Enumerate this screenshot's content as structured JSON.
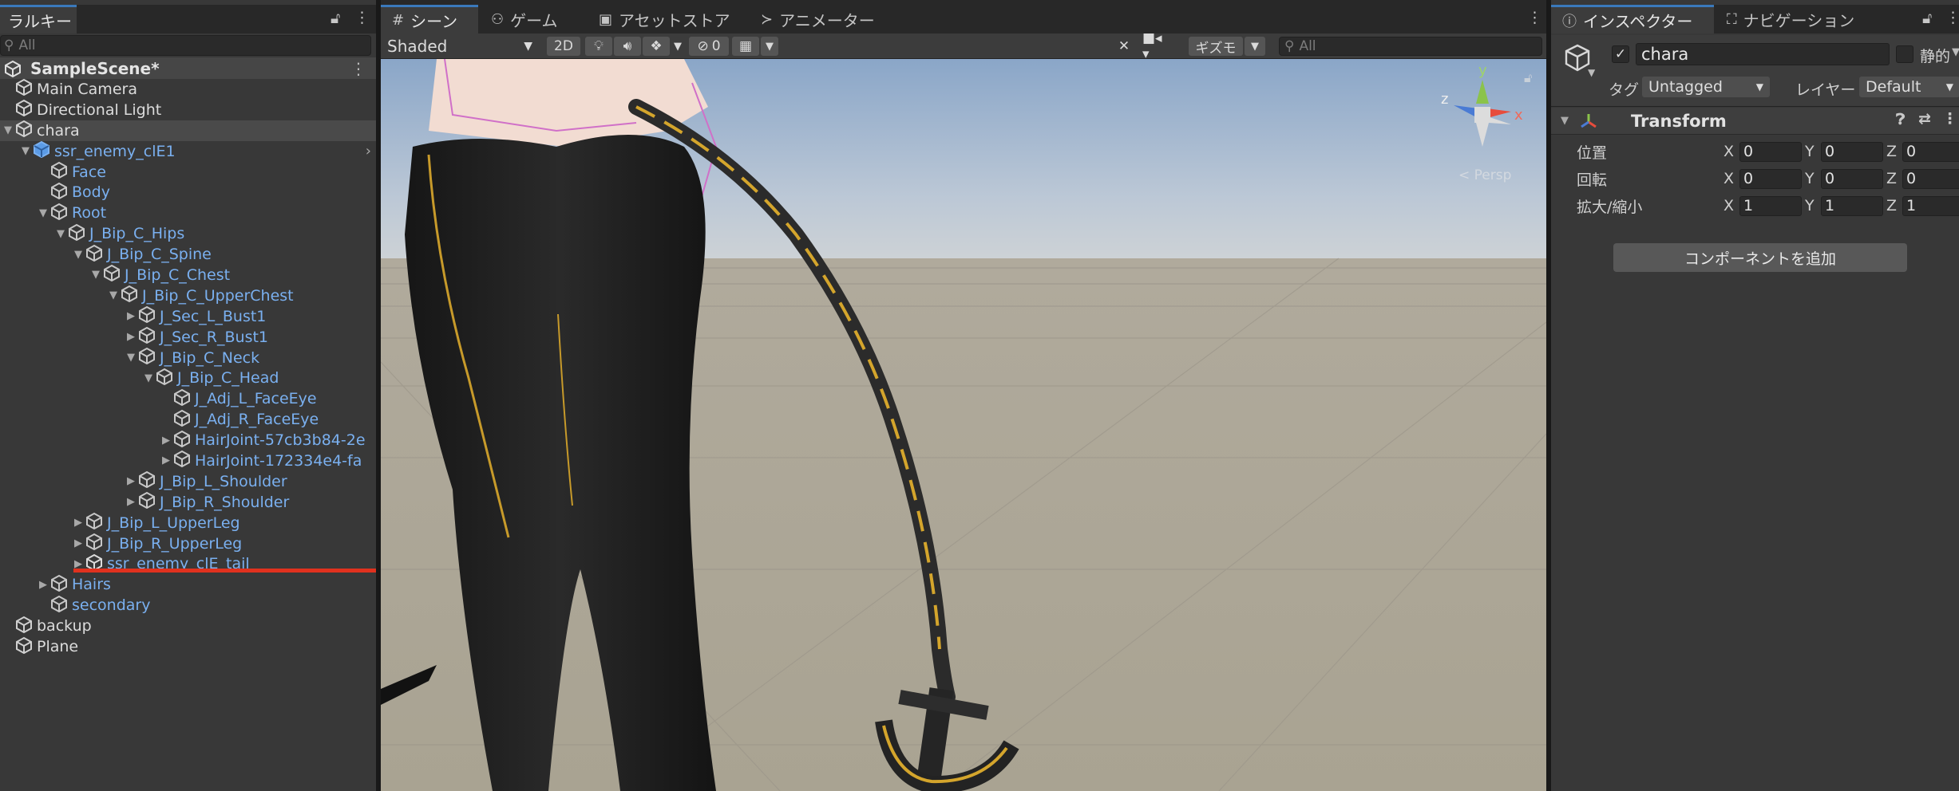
{
  "hierarchy": {
    "tab_label": "ラルキー",
    "search_placeholder": "All",
    "scene_name": "SampleScene*",
    "rows": [
      {
        "label": "Main Camera",
        "depth": 0,
        "arrow": "",
        "color": "white",
        "icon": "cube"
      },
      {
        "label": "Directional Light",
        "depth": 0,
        "arrow": "",
        "color": "white",
        "icon": "cube"
      },
      {
        "label": "chara",
        "depth": 0,
        "arrow": "▼",
        "color": "white",
        "icon": "cube",
        "selected": true
      },
      {
        "label": "ssr_enemy_clE1",
        "depth": 1,
        "arrow": "▼",
        "color": "blue",
        "icon": "prefab",
        "chevron": true
      },
      {
        "label": "Face",
        "depth": 2,
        "arrow": "",
        "color": "blue",
        "icon": "cube"
      },
      {
        "label": "Body",
        "depth": 2,
        "arrow": "",
        "color": "blue",
        "icon": "cube"
      },
      {
        "label": "Root",
        "depth": 2,
        "arrow": "▼",
        "color": "blue",
        "icon": "cube"
      },
      {
        "label": "J_Bip_C_Hips",
        "depth": 3,
        "arrow": "▼",
        "color": "blue",
        "icon": "cube"
      },
      {
        "label": "J_Bip_C_Spine",
        "depth": 4,
        "arrow": "▼",
        "color": "blue",
        "icon": "cube"
      },
      {
        "label": "J_Bip_C_Chest",
        "depth": 5,
        "arrow": "▼",
        "color": "blue",
        "icon": "cube"
      },
      {
        "label": "J_Bip_C_UpperChest",
        "depth": 6,
        "arrow": "▼",
        "color": "blue",
        "icon": "cube"
      },
      {
        "label": "J_Sec_L_Bust1",
        "depth": 7,
        "arrow": "▶",
        "color": "blue",
        "icon": "cube"
      },
      {
        "label": "J_Sec_R_Bust1",
        "depth": 7,
        "arrow": "▶",
        "color": "blue",
        "icon": "cube"
      },
      {
        "label": "J_Bip_C_Neck",
        "depth": 7,
        "arrow": "▼",
        "color": "blue",
        "icon": "cube"
      },
      {
        "label": "J_Bip_C_Head",
        "depth": 8,
        "arrow": "▼",
        "color": "blue",
        "icon": "cube"
      },
      {
        "label": "J_Adj_L_FaceEye",
        "depth": 9,
        "arrow": "",
        "color": "blue",
        "icon": "cube"
      },
      {
        "label": "J_Adj_R_FaceEye",
        "depth": 9,
        "arrow": "",
        "color": "blue",
        "icon": "cube"
      },
      {
        "label": "HairJoint-57cb3b84-2e",
        "depth": 9,
        "arrow": "▶",
        "color": "blue",
        "icon": "cube"
      },
      {
        "label": "HairJoint-172334e4-fa",
        "depth": 9,
        "arrow": "▶",
        "color": "blue",
        "icon": "cube"
      },
      {
        "label": "J_Bip_L_Shoulder",
        "depth": 7,
        "arrow": "▶",
        "color": "blue",
        "icon": "cube"
      },
      {
        "label": "J_Bip_R_Shoulder",
        "depth": 7,
        "arrow": "▶",
        "color": "blue",
        "icon": "cube"
      },
      {
        "label": "J_Bip_L_UpperLeg",
        "depth": 4,
        "arrow": "▶",
        "color": "blue",
        "icon": "cube"
      },
      {
        "label": "J_Bip_R_UpperLeg",
        "depth": 4,
        "arrow": "▶",
        "color": "blue",
        "icon": "cube"
      },
      {
        "label": "ssr_enemy_clE_tail",
        "depth": 4,
        "arrow": "▶",
        "color": "blue",
        "icon": "prefab-broken"
      },
      {
        "label": "Hairs",
        "depth": 2,
        "arrow": "▶",
        "color": "blue",
        "icon": "cube"
      },
      {
        "label": "secondary",
        "depth": 2,
        "arrow": "",
        "color": "blue",
        "icon": "cube"
      },
      {
        "label": "backup",
        "depth": 0,
        "arrow": "",
        "color": "white",
        "icon": "cube"
      },
      {
        "label": "Plane",
        "depth": 0,
        "arrow": "",
        "color": "white",
        "icon": "cube"
      }
    ]
  },
  "scene": {
    "tabs": {
      "scene": "シーン",
      "game": "ゲーム",
      "asset_store": "アセットストア",
      "animator": "アニメーター"
    },
    "shading_mode": "Shaded",
    "mode_2d": "2D",
    "hidden_count": "0",
    "gizmos_label": "ギズモ",
    "search_placeholder": "All",
    "gizmo_axes": {
      "x": "x",
      "y": "y",
      "z": "z"
    },
    "persp_label": "< Persp"
  },
  "inspector": {
    "tabs": {
      "inspector": "インスペクター",
      "navigation": "ナビゲーション"
    },
    "object_name": "chara",
    "static_label": "静的",
    "tag_label": "タグ",
    "tag_value": "Untagged",
    "layer_label": "レイヤー",
    "layer_value": "Default",
    "component_title": "Transform",
    "position_label": "位置",
    "rotation_label": "回転",
    "scale_label": "拡大/縮小",
    "position": {
      "x": "0",
      "y": "0",
      "z": "0"
    },
    "rotation": {
      "x": "0",
      "y": "0",
      "z": "0"
    },
    "scale": {
      "x": "1",
      "y": "1",
      "z": "1"
    },
    "axis_x": "X",
    "axis_y": "Y",
    "axis_z": "Z",
    "add_component": "コンポーネントを追加"
  },
  "colors": {
    "accent_blue": "#3a79bb",
    "prefab_blue": "#7ab0f0",
    "highlight_red": "#e0311e"
  }
}
